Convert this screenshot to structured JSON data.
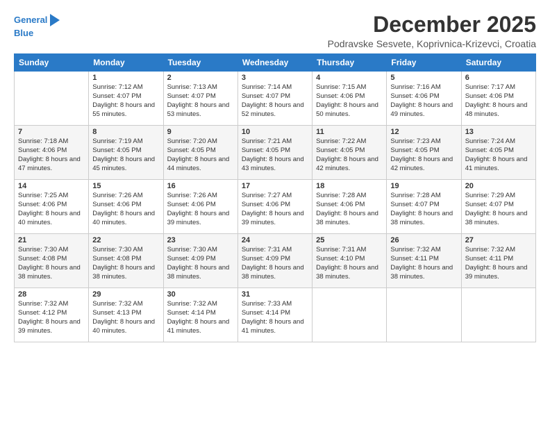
{
  "logo": {
    "line1": "General",
    "line2": "Blue",
    "icon": "▶"
  },
  "title": "December 2025",
  "location": "Podravske Sesvete, Koprivnica-Krizevci, Croatia",
  "weekdays": [
    "Sunday",
    "Monday",
    "Tuesday",
    "Wednesday",
    "Thursday",
    "Friday",
    "Saturday"
  ],
  "weeks": [
    [
      {
        "day": "",
        "sunrise": "",
        "sunset": "",
        "daylight": ""
      },
      {
        "day": "1",
        "sunrise": "Sunrise: 7:12 AM",
        "sunset": "Sunset: 4:07 PM",
        "daylight": "Daylight: 8 hours and 55 minutes."
      },
      {
        "day": "2",
        "sunrise": "Sunrise: 7:13 AM",
        "sunset": "Sunset: 4:07 PM",
        "daylight": "Daylight: 8 hours and 53 minutes."
      },
      {
        "day": "3",
        "sunrise": "Sunrise: 7:14 AM",
        "sunset": "Sunset: 4:07 PM",
        "daylight": "Daylight: 8 hours and 52 minutes."
      },
      {
        "day": "4",
        "sunrise": "Sunrise: 7:15 AM",
        "sunset": "Sunset: 4:06 PM",
        "daylight": "Daylight: 8 hours and 50 minutes."
      },
      {
        "day": "5",
        "sunrise": "Sunrise: 7:16 AM",
        "sunset": "Sunset: 4:06 PM",
        "daylight": "Daylight: 8 hours and 49 minutes."
      },
      {
        "day": "6",
        "sunrise": "Sunrise: 7:17 AM",
        "sunset": "Sunset: 4:06 PM",
        "daylight": "Daylight: 8 hours and 48 minutes."
      }
    ],
    [
      {
        "day": "7",
        "sunrise": "Sunrise: 7:18 AM",
        "sunset": "Sunset: 4:06 PM",
        "daylight": "Daylight: 8 hours and 47 minutes."
      },
      {
        "day": "8",
        "sunrise": "Sunrise: 7:19 AM",
        "sunset": "Sunset: 4:05 PM",
        "daylight": "Daylight: 8 hours and 45 minutes."
      },
      {
        "day": "9",
        "sunrise": "Sunrise: 7:20 AM",
        "sunset": "Sunset: 4:05 PM",
        "daylight": "Daylight: 8 hours and 44 minutes."
      },
      {
        "day": "10",
        "sunrise": "Sunrise: 7:21 AM",
        "sunset": "Sunset: 4:05 PM",
        "daylight": "Daylight: 8 hours and 43 minutes."
      },
      {
        "day": "11",
        "sunrise": "Sunrise: 7:22 AM",
        "sunset": "Sunset: 4:05 PM",
        "daylight": "Daylight: 8 hours and 42 minutes."
      },
      {
        "day": "12",
        "sunrise": "Sunrise: 7:23 AM",
        "sunset": "Sunset: 4:05 PM",
        "daylight": "Daylight: 8 hours and 42 minutes."
      },
      {
        "day": "13",
        "sunrise": "Sunrise: 7:24 AM",
        "sunset": "Sunset: 4:05 PM",
        "daylight": "Daylight: 8 hours and 41 minutes."
      }
    ],
    [
      {
        "day": "14",
        "sunrise": "Sunrise: 7:25 AM",
        "sunset": "Sunset: 4:06 PM",
        "daylight": "Daylight: 8 hours and 40 minutes."
      },
      {
        "day": "15",
        "sunrise": "Sunrise: 7:26 AM",
        "sunset": "Sunset: 4:06 PM",
        "daylight": "Daylight: 8 hours and 40 minutes."
      },
      {
        "day": "16",
        "sunrise": "Sunrise: 7:26 AM",
        "sunset": "Sunset: 4:06 PM",
        "daylight": "Daylight: 8 hours and 39 minutes."
      },
      {
        "day": "17",
        "sunrise": "Sunrise: 7:27 AM",
        "sunset": "Sunset: 4:06 PM",
        "daylight": "Daylight: 8 hours and 39 minutes."
      },
      {
        "day": "18",
        "sunrise": "Sunrise: 7:28 AM",
        "sunset": "Sunset: 4:06 PM",
        "daylight": "Daylight: 8 hours and 38 minutes."
      },
      {
        "day": "19",
        "sunrise": "Sunrise: 7:28 AM",
        "sunset": "Sunset: 4:07 PM",
        "daylight": "Daylight: 8 hours and 38 minutes."
      },
      {
        "day": "20",
        "sunrise": "Sunrise: 7:29 AM",
        "sunset": "Sunset: 4:07 PM",
        "daylight": "Daylight: 8 hours and 38 minutes."
      }
    ],
    [
      {
        "day": "21",
        "sunrise": "Sunrise: 7:30 AM",
        "sunset": "Sunset: 4:08 PM",
        "daylight": "Daylight: 8 hours and 38 minutes."
      },
      {
        "day": "22",
        "sunrise": "Sunrise: 7:30 AM",
        "sunset": "Sunset: 4:08 PM",
        "daylight": "Daylight: 8 hours and 38 minutes."
      },
      {
        "day": "23",
        "sunrise": "Sunrise: 7:30 AM",
        "sunset": "Sunset: 4:09 PM",
        "daylight": "Daylight: 8 hours and 38 minutes."
      },
      {
        "day": "24",
        "sunrise": "Sunrise: 7:31 AM",
        "sunset": "Sunset: 4:09 PM",
        "daylight": "Daylight: 8 hours and 38 minutes."
      },
      {
        "day": "25",
        "sunrise": "Sunrise: 7:31 AM",
        "sunset": "Sunset: 4:10 PM",
        "daylight": "Daylight: 8 hours and 38 minutes."
      },
      {
        "day": "26",
        "sunrise": "Sunrise: 7:32 AM",
        "sunset": "Sunset: 4:11 PM",
        "daylight": "Daylight: 8 hours and 38 minutes."
      },
      {
        "day": "27",
        "sunrise": "Sunrise: 7:32 AM",
        "sunset": "Sunset: 4:11 PM",
        "daylight": "Daylight: 8 hours and 39 minutes."
      }
    ],
    [
      {
        "day": "28",
        "sunrise": "Sunrise: 7:32 AM",
        "sunset": "Sunset: 4:12 PM",
        "daylight": "Daylight: 8 hours and 39 minutes."
      },
      {
        "day": "29",
        "sunrise": "Sunrise: 7:32 AM",
        "sunset": "Sunset: 4:13 PM",
        "daylight": "Daylight: 8 hours and 40 minutes."
      },
      {
        "day": "30",
        "sunrise": "Sunrise: 7:32 AM",
        "sunset": "Sunset: 4:14 PM",
        "daylight": "Daylight: 8 hours and 41 minutes."
      },
      {
        "day": "31",
        "sunrise": "Sunrise: 7:33 AM",
        "sunset": "Sunset: 4:14 PM",
        "daylight": "Daylight: 8 hours and 41 minutes."
      },
      {
        "day": "",
        "sunrise": "",
        "sunset": "",
        "daylight": ""
      },
      {
        "day": "",
        "sunrise": "",
        "sunset": "",
        "daylight": ""
      },
      {
        "day": "",
        "sunrise": "",
        "sunset": "",
        "daylight": ""
      }
    ]
  ]
}
